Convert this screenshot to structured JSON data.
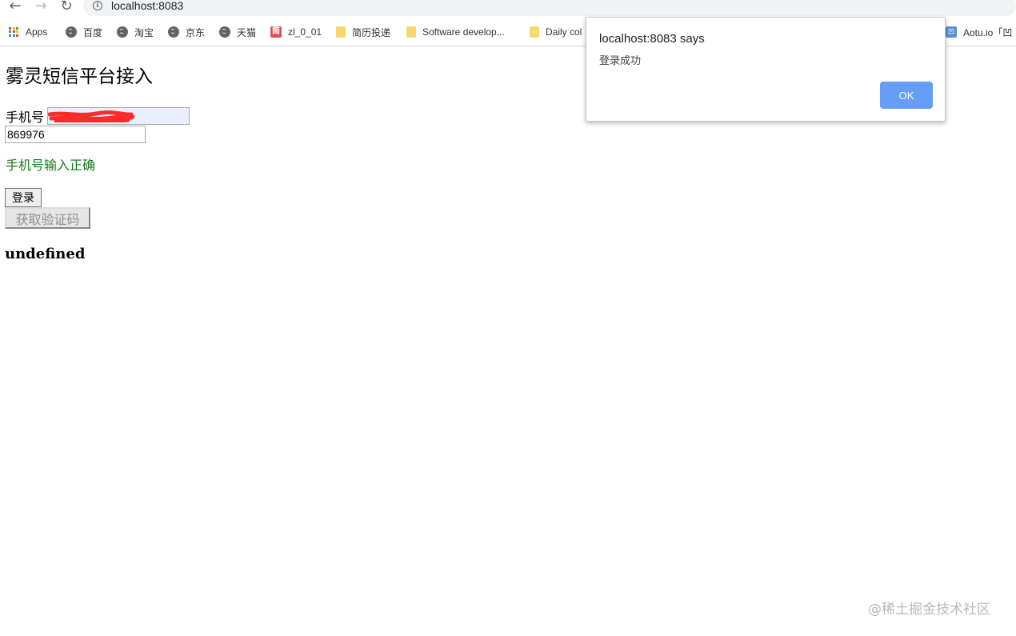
{
  "browser": {
    "url": "localhost:8083",
    "bookmarks": [
      {
        "label": "Apps",
        "icon": "apps-grid-icon"
      },
      {
        "label": "百度",
        "icon": "globe-icon"
      },
      {
        "label": "淘宝",
        "icon": "globe-icon"
      },
      {
        "label": "京东",
        "icon": "globe-icon"
      },
      {
        "label": "天猫",
        "icon": "globe-icon"
      },
      {
        "label": "zl_0_01",
        "icon": "jian-icon",
        "icon_text": "简"
      },
      {
        "label": "简历投递",
        "icon": "folder-icon"
      },
      {
        "label": "Software develop...",
        "icon": "folder-icon"
      },
      {
        "label": "Daily col",
        "icon": "folder-icon"
      },
      {
        "label": "Aotu.io「凹",
        "icon": "aotu-icon"
      }
    ]
  },
  "page": {
    "title": "雾灵短信平台接入",
    "phone_label": "手机号",
    "code_value": "869976",
    "phone_status": "手机号输入正确",
    "login_label": "登录",
    "get_code_label": "获取验证码",
    "result_text": "undefined"
  },
  "alert": {
    "title": "localhost:8083 says",
    "message": "登录成功",
    "ok_label": "OK"
  },
  "watermark": "@稀土掘金技术社区",
  "colors": {
    "status_green": "#1a7a1a",
    "ok_button": "#669df6",
    "redaction": "#ff2a2a"
  }
}
